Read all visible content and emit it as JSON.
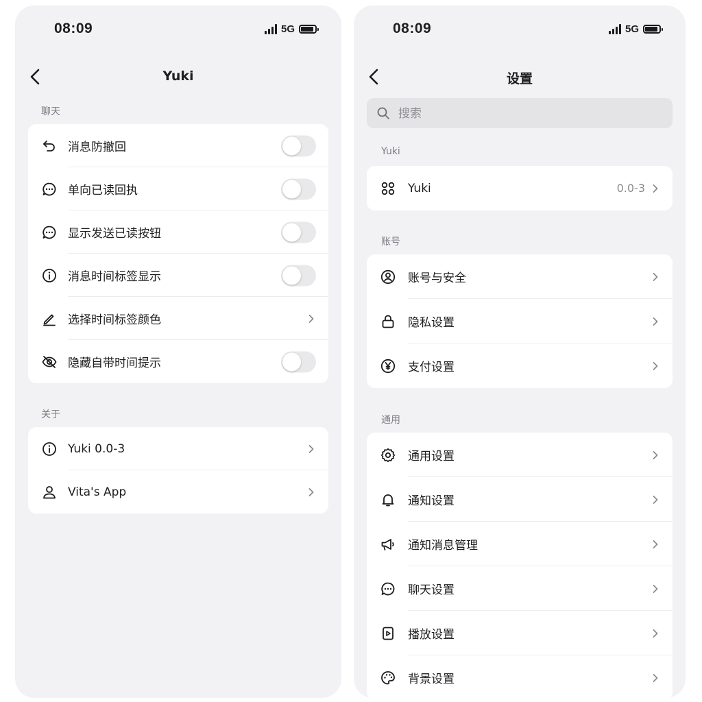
{
  "status_bar": {
    "time": "08:09",
    "network": "5G"
  },
  "left_screen": {
    "nav": {
      "title": "Yuki"
    },
    "sections": [
      {
        "label": "聊天",
        "rows": [
          {
            "label": "消息防撤回",
            "icon": "undo-icon",
            "control": "toggle",
            "checked": false
          },
          {
            "label": "单向已读回执",
            "icon": "chat-bubble-icon",
            "control": "toggle",
            "checked": false
          },
          {
            "label": "显示发送已读按钮",
            "icon": "chat-bubble-icon",
            "control": "toggle",
            "checked": false
          },
          {
            "label": "消息时间标签显示",
            "icon": "info-icon",
            "control": "toggle",
            "checked": false
          },
          {
            "label": "选择时间标签颜色",
            "icon": "pencil-icon",
            "control": "chevron"
          },
          {
            "label": "隐藏自带时间提示",
            "icon": "eye-off-icon",
            "control": "toggle",
            "checked": false
          }
        ]
      },
      {
        "label": "关于",
        "rows": [
          {
            "label": "Yuki 0.0-3",
            "icon": "info-icon",
            "control": "chevron"
          },
          {
            "label": "Vita's App",
            "icon": "person-icon",
            "control": "chevron"
          }
        ]
      }
    ]
  },
  "right_screen": {
    "nav": {
      "title": "设置"
    },
    "search": {
      "placeholder": "搜索",
      "value": ""
    },
    "sections": [
      {
        "label": "Yuki",
        "rows": [
          {
            "label": "Yuki",
            "icon": "grid-icon",
            "value": "0.0-3",
            "control": "chevron"
          }
        ]
      },
      {
        "label": "账号",
        "rows": [
          {
            "label": "账号与安全",
            "icon": "user-circle-icon",
            "control": "chevron"
          },
          {
            "label": "隐私设置",
            "icon": "lock-icon",
            "control": "chevron"
          },
          {
            "label": "支付设置",
            "icon": "yen-icon",
            "control": "chevron"
          }
        ]
      },
      {
        "label": "通用",
        "rows": [
          {
            "label": "通用设置",
            "icon": "gear-icon",
            "control": "chevron"
          },
          {
            "label": "通知设置",
            "icon": "bell-icon",
            "control": "chevron"
          },
          {
            "label": "通知消息管理",
            "icon": "megaphone-icon",
            "control": "chevron"
          },
          {
            "label": "聊天设置",
            "icon": "chat-bubble-icon",
            "control": "chevron"
          },
          {
            "label": "播放设置",
            "icon": "play-square-icon",
            "control": "chevron"
          },
          {
            "label": "背景设置",
            "icon": "palette-icon",
            "control": "chevron"
          }
        ]
      }
    ]
  },
  "colors": {
    "background": "#f2f2f5",
    "card": "#ffffff",
    "toggle_off": "#e9e9eb",
    "secondary_text": "#7d7d82"
  }
}
